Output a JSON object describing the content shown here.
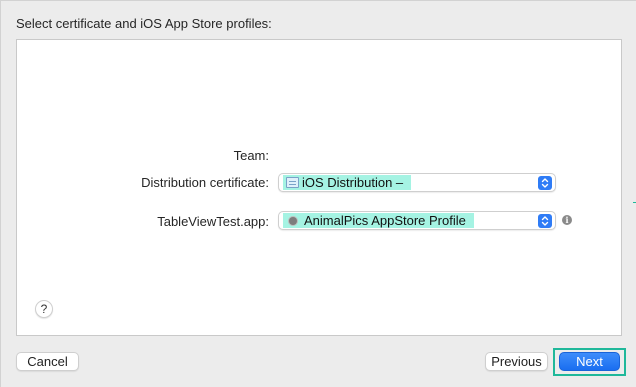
{
  "dialog": {
    "heading": "Select certificate and iOS App Store profiles:"
  },
  "form": {
    "team_label": "Team:",
    "team_value": "",
    "distribution_label": "Distribution certificate:",
    "distribution_value": "iOS Distribution –",
    "app_label": "TableViewTest.app:",
    "app_value": "AnimalPics AppStore Profile"
  },
  "buttons": {
    "help": "?",
    "cancel": "Cancel",
    "previous": "Previous",
    "next": "Next"
  },
  "info_icon_glyph": "i",
  "colors": {
    "accent": "#2f7cf6",
    "highlight": "#a5f3e3",
    "focus_frame": "#1fb89a"
  },
  "icons": [
    "certificate-icon",
    "profile-icon",
    "info-icon",
    "chevron-updown-icon",
    "help-icon"
  ]
}
